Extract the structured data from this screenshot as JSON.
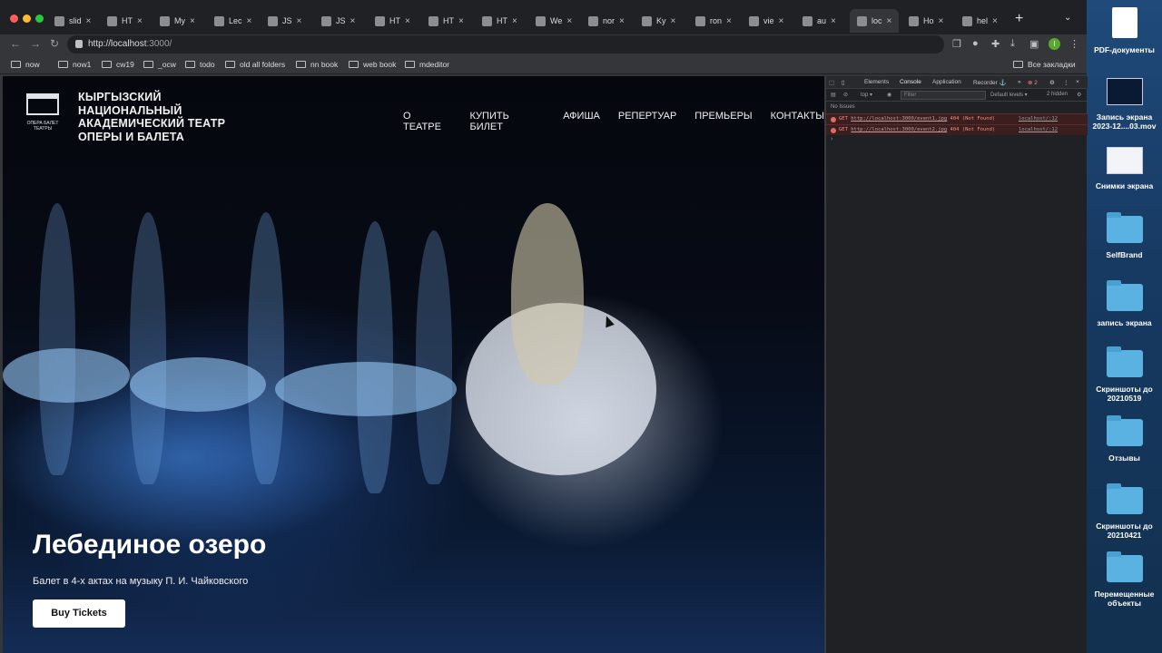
{
  "browser": {
    "tabs": [
      {
        "label": "slid"
      },
      {
        "label": "HT"
      },
      {
        "label": "My"
      },
      {
        "label": "Lec"
      },
      {
        "label": "JS"
      },
      {
        "label": "JS"
      },
      {
        "label": "HT"
      },
      {
        "label": "HT"
      },
      {
        "label": "HT"
      },
      {
        "label": "We"
      },
      {
        "label": "nor"
      },
      {
        "label": "Ky"
      },
      {
        "label": "ron"
      },
      {
        "label": "vie"
      },
      {
        "label": "au"
      },
      {
        "label": "loc"
      },
      {
        "label": "Ho"
      },
      {
        "label": "hel"
      }
    ],
    "active_tab_index": 15,
    "close_glyph": "×",
    "new_tab_glyph": "+",
    "url_display_host": "http://localhost",
    "url_display_path": ":3000/",
    "bookmarks": [
      {
        "label": "now"
      },
      {
        "label": "now1"
      },
      {
        "label": "cw19"
      },
      {
        "label": "_ocw"
      },
      {
        "label": "todo"
      },
      {
        "label": "old all folders"
      },
      {
        "label": "nn book"
      },
      {
        "label": "web book"
      },
      {
        "label": "mdeditor"
      }
    ],
    "all_bookmarks_label": "Все закладки",
    "profile_initial": "I"
  },
  "page": {
    "theatre_name": "КЫРГЫЗСКИЙ НАЦИОНАЛЬНЫЙ АКАДЕМИЧЕСКИЙ ТЕАТР ОПЕРЫ И БАЛЕТА",
    "logo_caption": "ОПЕРА БАЛЕТ ТЕАТРЫ",
    "nav": [
      {
        "label": "О ТЕАТРЕ"
      },
      {
        "label": "КУПИТЬ БИЛЕТ"
      },
      {
        "label": "АФИША"
      },
      {
        "label": "РЕПЕРТУАР"
      },
      {
        "label": "ПРЕМЬЕРЫ"
      },
      {
        "label": "КОНТАКТЫ"
      }
    ],
    "hero_title": "Лебединое озеро",
    "hero_subtitle": "Балет в 4-х актах на музыку П. И. Чайковского",
    "buy_button": "Buy Tickets"
  },
  "devtools": {
    "tabs": [
      "Elements",
      "Console",
      "Application",
      "Recorder ⚓"
    ],
    "error_count": "2",
    "context": "top",
    "filter_placeholder": "Filter",
    "levels": "Default levels ▾",
    "hidden": "2 hidden",
    "no_issues": "No Issues",
    "errors": [
      {
        "method": "GET",
        "url": "http://localhost:3000/event1.jpg",
        "status": "404 (Not Found)",
        "source": "localhost/:12"
      },
      {
        "method": "GET",
        "url": "http://localhost:3000/event2.jpg",
        "status": "404 (Not Found)",
        "source": "localhost/:12"
      }
    ],
    "prompt": "›"
  },
  "desktop": {
    "items": [
      {
        "label": "PDF-документы",
        "kind": "doc"
      },
      {
        "label": "Запись экрана 2023-12....03.mov",
        "kind": "thumb"
      },
      {
        "label": "Снимки экрана",
        "kind": "thumb-white"
      },
      {
        "label": "SelfBrand",
        "kind": "folder"
      },
      {
        "label": "запись экрана",
        "kind": "folder"
      },
      {
        "label": "Скриншоты до 20210519",
        "kind": "folder"
      },
      {
        "label": "Отзывы",
        "kind": "folder"
      },
      {
        "label": "Скриншоты до 20210421",
        "kind": "folder"
      },
      {
        "label": "Перемещенные объекты",
        "kind": "folder"
      }
    ]
  },
  "colors": {
    "tabbar_bg": "#202124",
    "toolbar_bg": "#35363a",
    "devtools_error_bg": "#3b1e1e",
    "error_text": "#f28b82",
    "desktop_folder": "#5ab2e2"
  }
}
